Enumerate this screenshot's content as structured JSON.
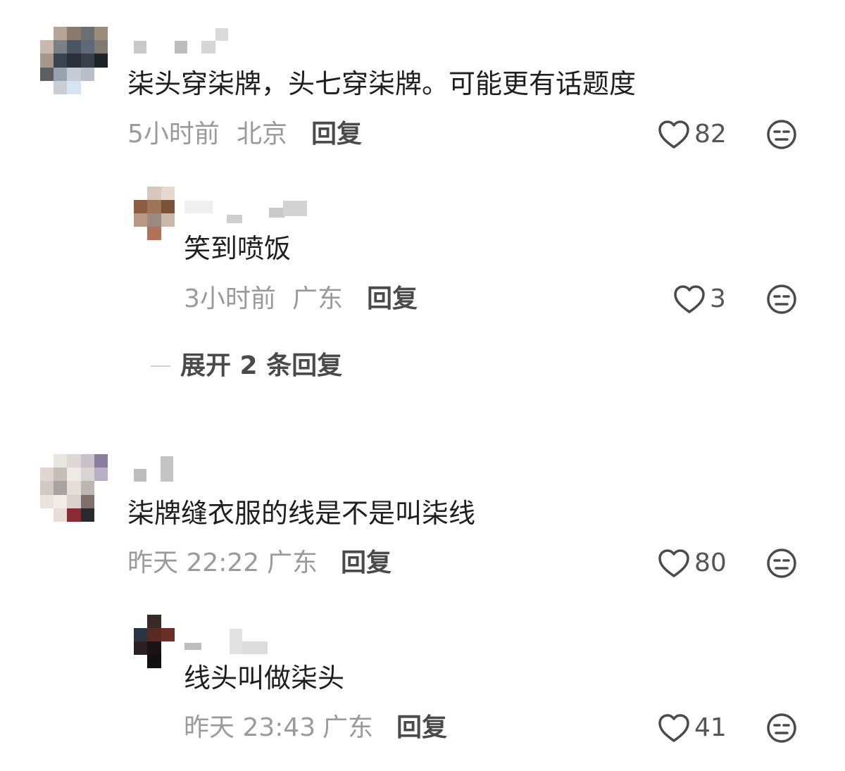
{
  "comments": [
    {
      "text": "柒头穿柒牌，头七穿柒牌。可能更有话题度",
      "time": "5小时前",
      "location": "北京",
      "reply_label": "回复",
      "likes": "82",
      "reply": {
        "text": "笑到喷饭",
        "time": "3小时前",
        "location": "广东",
        "reply_label": "回复",
        "likes": "3"
      },
      "expand_label": "展开 2 条回复"
    },
    {
      "text": "柒牌缝衣服的线是不是叫柒线",
      "time": "昨天 22:22",
      "location": "广东",
      "reply_label": "回复",
      "likes": "80",
      "reply": {
        "text": "线头叫做柒头",
        "time": "昨天 23:43",
        "location": "广东",
        "reply_label": "回复",
        "likes": "41"
      }
    }
  ],
  "icons": {
    "like": "heart-outline-icon",
    "react": "neutral-face-icon"
  },
  "colors": {
    "meta": "#9a9a9a",
    "text": "#1e1e1e",
    "icon": "#4a4a4a"
  }
}
